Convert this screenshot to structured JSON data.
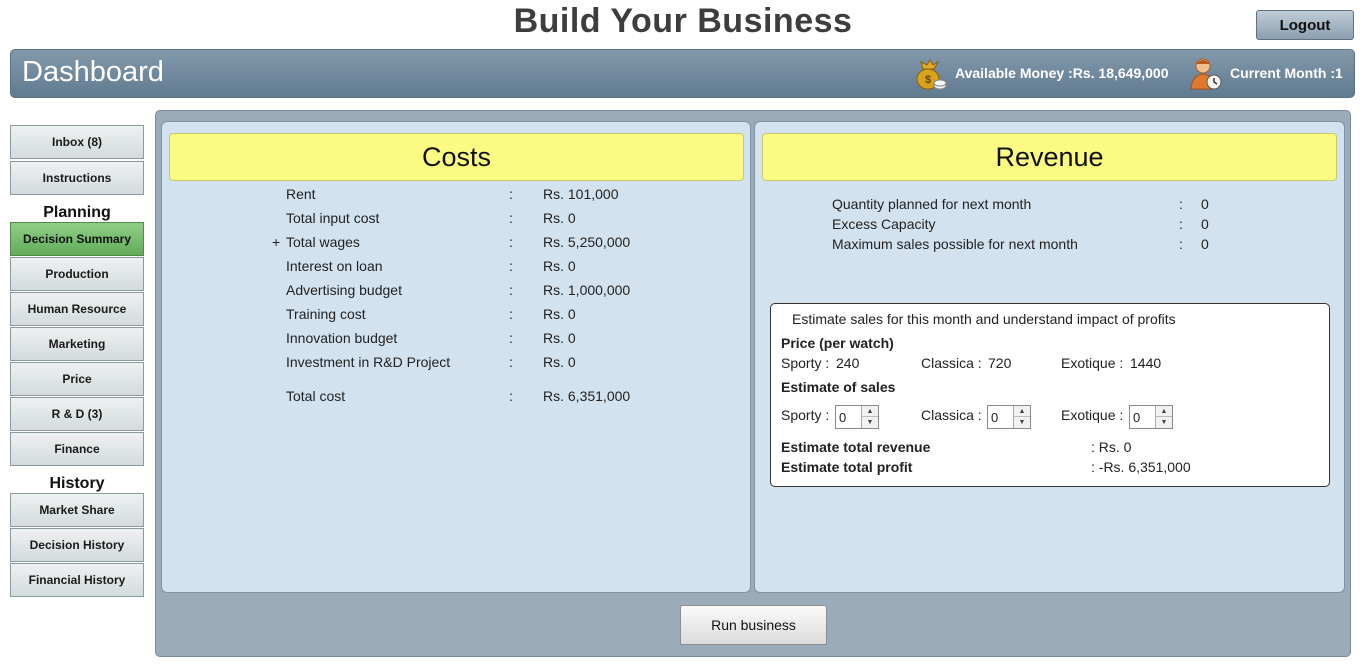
{
  "header": {
    "app_title": "Build Your Business",
    "logout_label": "Logout"
  },
  "dashboard": {
    "title": "Dashboard",
    "available_money": "Available Money :Rs. 18,649,000",
    "current_month": "Current Month :1"
  },
  "sidebar": {
    "top_items": [
      {
        "label": "Inbox (8)"
      },
      {
        "label": "Instructions"
      }
    ],
    "planning_heading": "Planning",
    "planning_items": [
      {
        "label": "Decision Summary"
      },
      {
        "label": "Production"
      },
      {
        "label": "Human Resource"
      },
      {
        "label": "Marketing"
      },
      {
        "label": "Price"
      },
      {
        "label": "R & D (3)"
      },
      {
        "label": "Finance"
      }
    ],
    "history_heading": "History",
    "history_items": [
      {
        "label": "Market Share"
      },
      {
        "label": "Decision History"
      },
      {
        "label": "Financial History"
      }
    ]
  },
  "costs": {
    "title": "Costs",
    "expand_symbol": "+",
    "separator": ":",
    "rows": [
      {
        "label": "Rent",
        "value": "Rs. 101,000"
      },
      {
        "label": "Total input cost",
        "value": "Rs. 0"
      },
      {
        "label": "Total wages",
        "value": "Rs. 5,250,000"
      },
      {
        "label": "Interest on loan",
        "value": "Rs. 0"
      },
      {
        "label": "Advertising budget",
        "value": "Rs. 1,000,000"
      },
      {
        "label": "Training cost",
        "value": "Rs. 0"
      },
      {
        "label": "Innovation budget",
        "value": "Rs. 0"
      },
      {
        "label": "Investment in R&D Project",
        "value": "Rs. 0"
      }
    ],
    "total": {
      "label": "Total cost",
      "value": "Rs. 6,351,000"
    }
  },
  "revenue": {
    "title": "Revenue",
    "rows": [
      {
        "label": "Quantity planned for next month",
        "value": "0"
      },
      {
        "label": "Excess Capacity",
        "value": "0"
      },
      {
        "label": "Maximum sales possible for next month",
        "value": "0"
      }
    ],
    "estimate": {
      "title": "Estimate sales for this month and understand impact of profits",
      "price_heading": "Price (per watch)",
      "prices": [
        {
          "label": "Sporty :",
          "value": "240"
        },
        {
          "label": "Classica :",
          "value": "720"
        },
        {
          "label": "Exotique :",
          "value": "1440"
        }
      ],
      "sales_heading": "Estimate of sales",
      "sales": [
        {
          "label": "Sporty :",
          "value": "0"
        },
        {
          "label": "Classica :",
          "value": "0"
        },
        {
          "label": "Exotique :",
          "value": "0"
        }
      ],
      "total_revenue_label": "Estimate total revenue",
      "total_revenue_value": ": Rs. 0",
      "total_profit_label": "Estimate total profit",
      "total_profit_value": ": -Rs. 6,351,000"
    }
  },
  "run_button_label": "Run business"
}
